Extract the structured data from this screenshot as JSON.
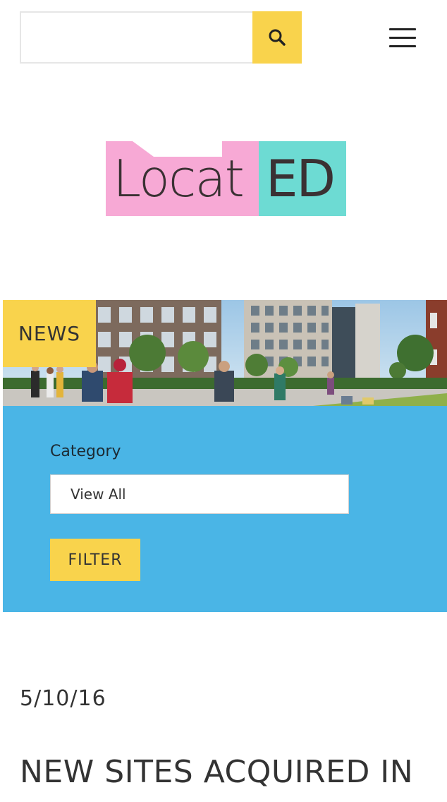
{
  "header": {
    "search_placeholder": "",
    "search_icon": "search-icon",
    "menu_icon": "hamburger-menu-icon"
  },
  "logo": {
    "part1": "Locat",
    "part2": "ED",
    "colors": {
      "pink": "#f7a9d5",
      "teal": "#6ddbd3",
      "text": "#3a3133"
    }
  },
  "banner": {
    "tag": "NEWS"
  },
  "filter": {
    "label": "Category",
    "selected": "View All",
    "button_label": "FILTER"
  },
  "article": {
    "date": "5/10/16",
    "title": "NEW SITES ACQUIRED IN"
  },
  "colors": {
    "accent_yellow": "#f9d34c",
    "panel_blue": "#4ab5e6"
  }
}
